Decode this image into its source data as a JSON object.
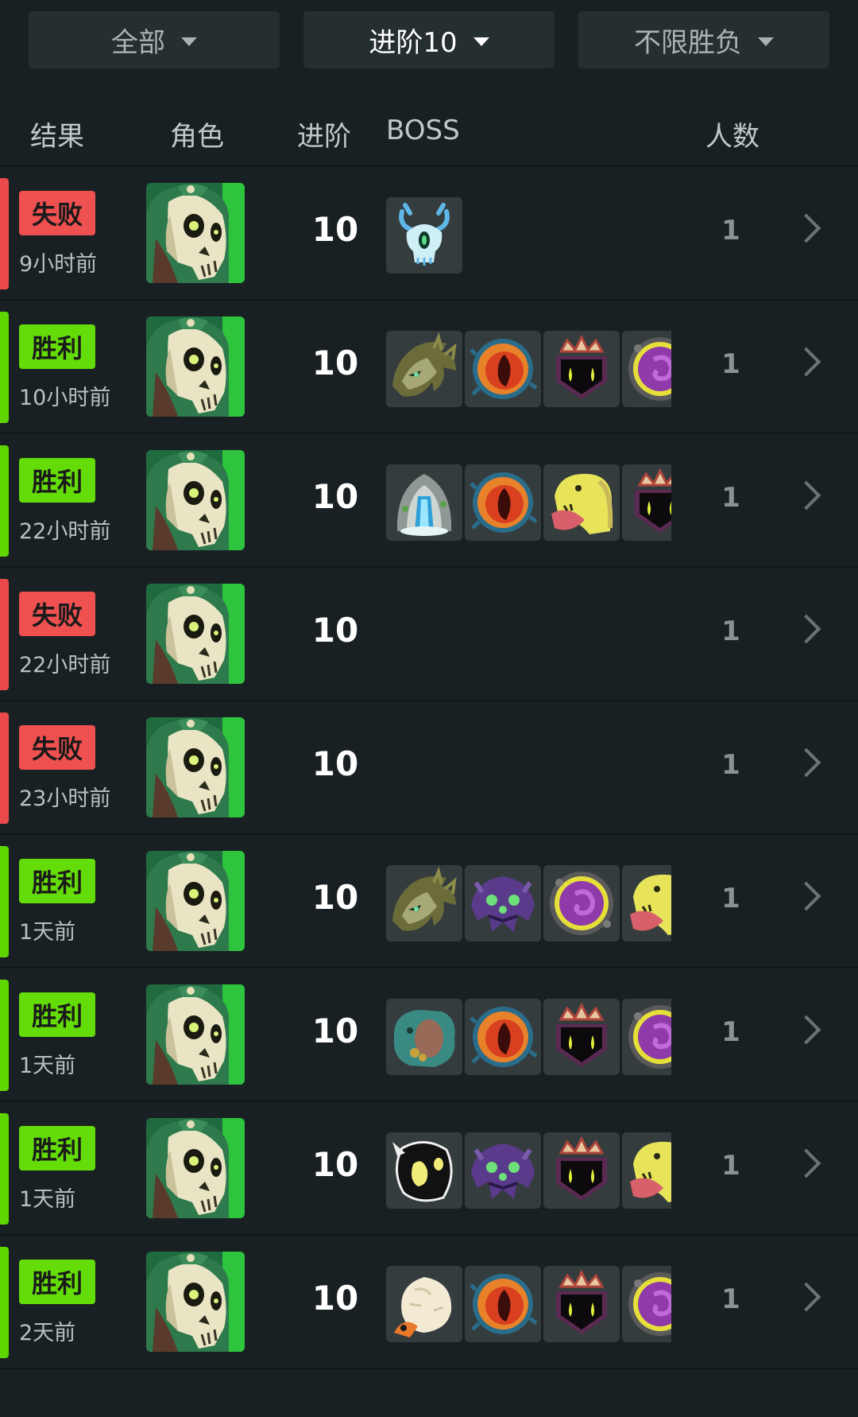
{
  "filters": [
    {
      "label": "全部",
      "active": false
    },
    {
      "label": "进阶10",
      "active": true
    },
    {
      "label": "不限胜负",
      "active": false
    }
  ],
  "columns": {
    "result": "结果",
    "character": "角色",
    "ascension": "进阶",
    "boss": "BOSS",
    "players": "人数"
  },
  "colors": {
    "win": "#63dc08",
    "loss": "#ef5050",
    "background": "#192023"
  },
  "rows": [
    {
      "result": "失败",
      "outcome": "loss",
      "time": "9小时前",
      "character": "silent-skull-icon",
      "ascension": "10",
      "players": "1",
      "bosses": [
        "awakened-one-icon"
      ]
    },
    {
      "result": "胜利",
      "outcome": "win",
      "time": "10小时前",
      "character": "silent-skull-icon",
      "ascension": "10",
      "players": "1",
      "bosses": [
        "hexaghost-icon",
        "slime-boss-icon",
        "champ-icon",
        "collector-icon"
      ]
    },
    {
      "result": "胜利",
      "outcome": "win",
      "time": "22小时前",
      "character": "silent-skull-icon",
      "ascension": "10",
      "players": "1",
      "bosses": [
        "guardian-icon",
        "slime-boss-icon",
        "time-eater-icon",
        "champ-icon"
      ]
    },
    {
      "result": "失败",
      "outcome": "loss",
      "time": "22小时前",
      "character": "silent-skull-icon",
      "ascension": "10",
      "players": "1",
      "bosses": []
    },
    {
      "result": "失败",
      "outcome": "loss",
      "time": "23小时前",
      "character": "silent-skull-icon",
      "ascension": "10",
      "players": "1",
      "bosses": []
    },
    {
      "result": "胜利",
      "outcome": "win",
      "time": "1天前",
      "character": "silent-skull-icon",
      "ascension": "10",
      "players": "1",
      "bosses": [
        "hexaghost-icon",
        "automaton-icon",
        "collector-icon",
        "time-eater-icon"
      ]
    },
    {
      "result": "胜利",
      "outcome": "win",
      "time": "1天前",
      "character": "silent-skull-icon",
      "ascension": "10",
      "players": "1",
      "bosses": [
        "donu-deca-icon",
        "slime-boss-icon",
        "champ-icon",
        "collector-icon"
      ]
    },
    {
      "result": "胜利",
      "outcome": "win",
      "time": "1天前",
      "character": "silent-skull-icon",
      "ascension": "10",
      "players": "1",
      "bosses": [
        "shape-icon",
        "automaton-icon",
        "champ-icon",
        "time-eater-icon"
      ]
    },
    {
      "result": "胜利",
      "outcome": "win",
      "time": "2天前",
      "character": "silent-skull-icon",
      "ascension": "10",
      "players": "1",
      "bosses": [
        "heart-shell-icon",
        "slime-boss-icon",
        "champ-icon",
        "collector-icon"
      ]
    }
  ]
}
